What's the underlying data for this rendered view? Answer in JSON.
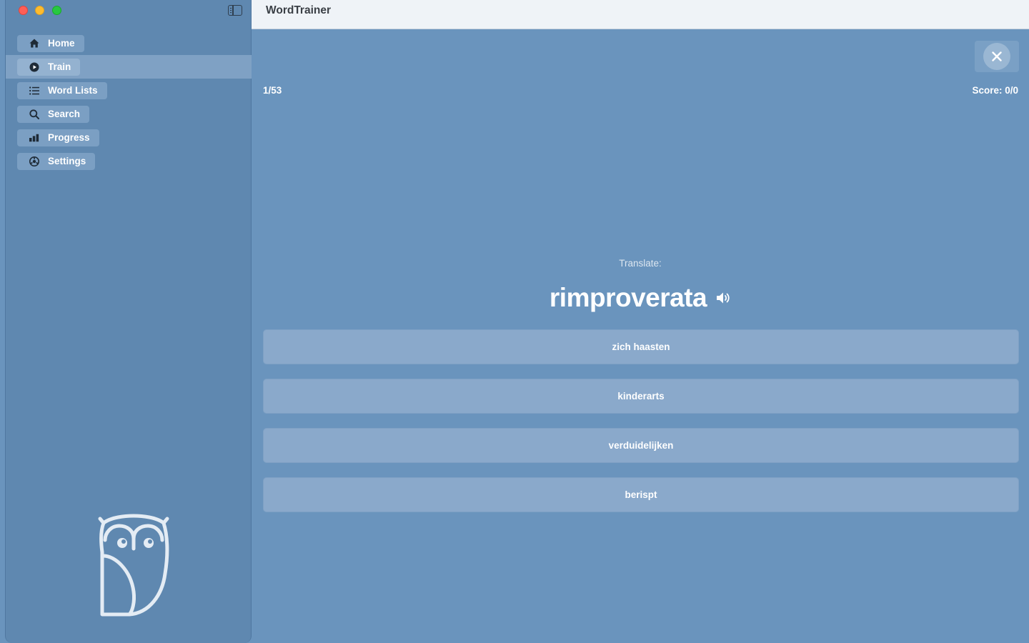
{
  "app": {
    "title": "WordTrainer"
  },
  "sidebar": {
    "items": [
      {
        "label": "Home",
        "icon": "house-icon"
      },
      {
        "label": "Train",
        "icon": "play-circle-icon",
        "selected": true
      },
      {
        "label": "Word Lists",
        "icon": "list-icon"
      },
      {
        "label": "Search",
        "icon": "search-icon"
      },
      {
        "label": "Progress",
        "icon": "bar-chart-icon"
      },
      {
        "label": "Settings",
        "icon": "gear-icon"
      }
    ],
    "logo": "owl-logo"
  },
  "quiz": {
    "counter": "1/53",
    "score": "Score: 0/0",
    "prompt_label": "Translate:",
    "word": "rimproverata",
    "answers": [
      "zich haasten",
      "kinderarts",
      "verduidelijken",
      "berispt"
    ]
  },
  "colors": {
    "background": "#6a94bd",
    "sidebar": "#5f88b0",
    "answer_button": "#8aa9cb",
    "titlebar": "#eff3f7"
  }
}
